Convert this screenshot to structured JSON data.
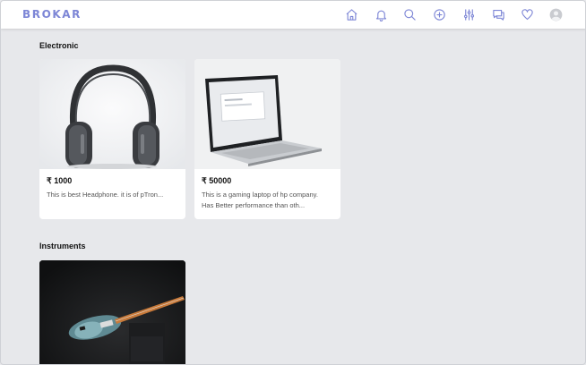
{
  "app": {
    "brand": "BROKAR",
    "accent": "#7d86d6"
  },
  "nav": {
    "icons": [
      "home-icon",
      "bell-icon",
      "search-icon",
      "add-circle-icon",
      "sliders-icon",
      "chat-icon",
      "heart-icon",
      "avatar-icon"
    ]
  },
  "sections": [
    {
      "title": "Electronic",
      "products": [
        {
          "price": "₹ 1000",
          "description": "This is best Headphone. it is of pTron..."
        },
        {
          "price": "₹ 50000",
          "description_line1": "This is a gaming laptop of hp company.",
          "description_line2": "Has Better performance than oth..."
        }
      ]
    },
    {
      "title": "Instruments",
      "products": [
        {}
      ]
    }
  ]
}
